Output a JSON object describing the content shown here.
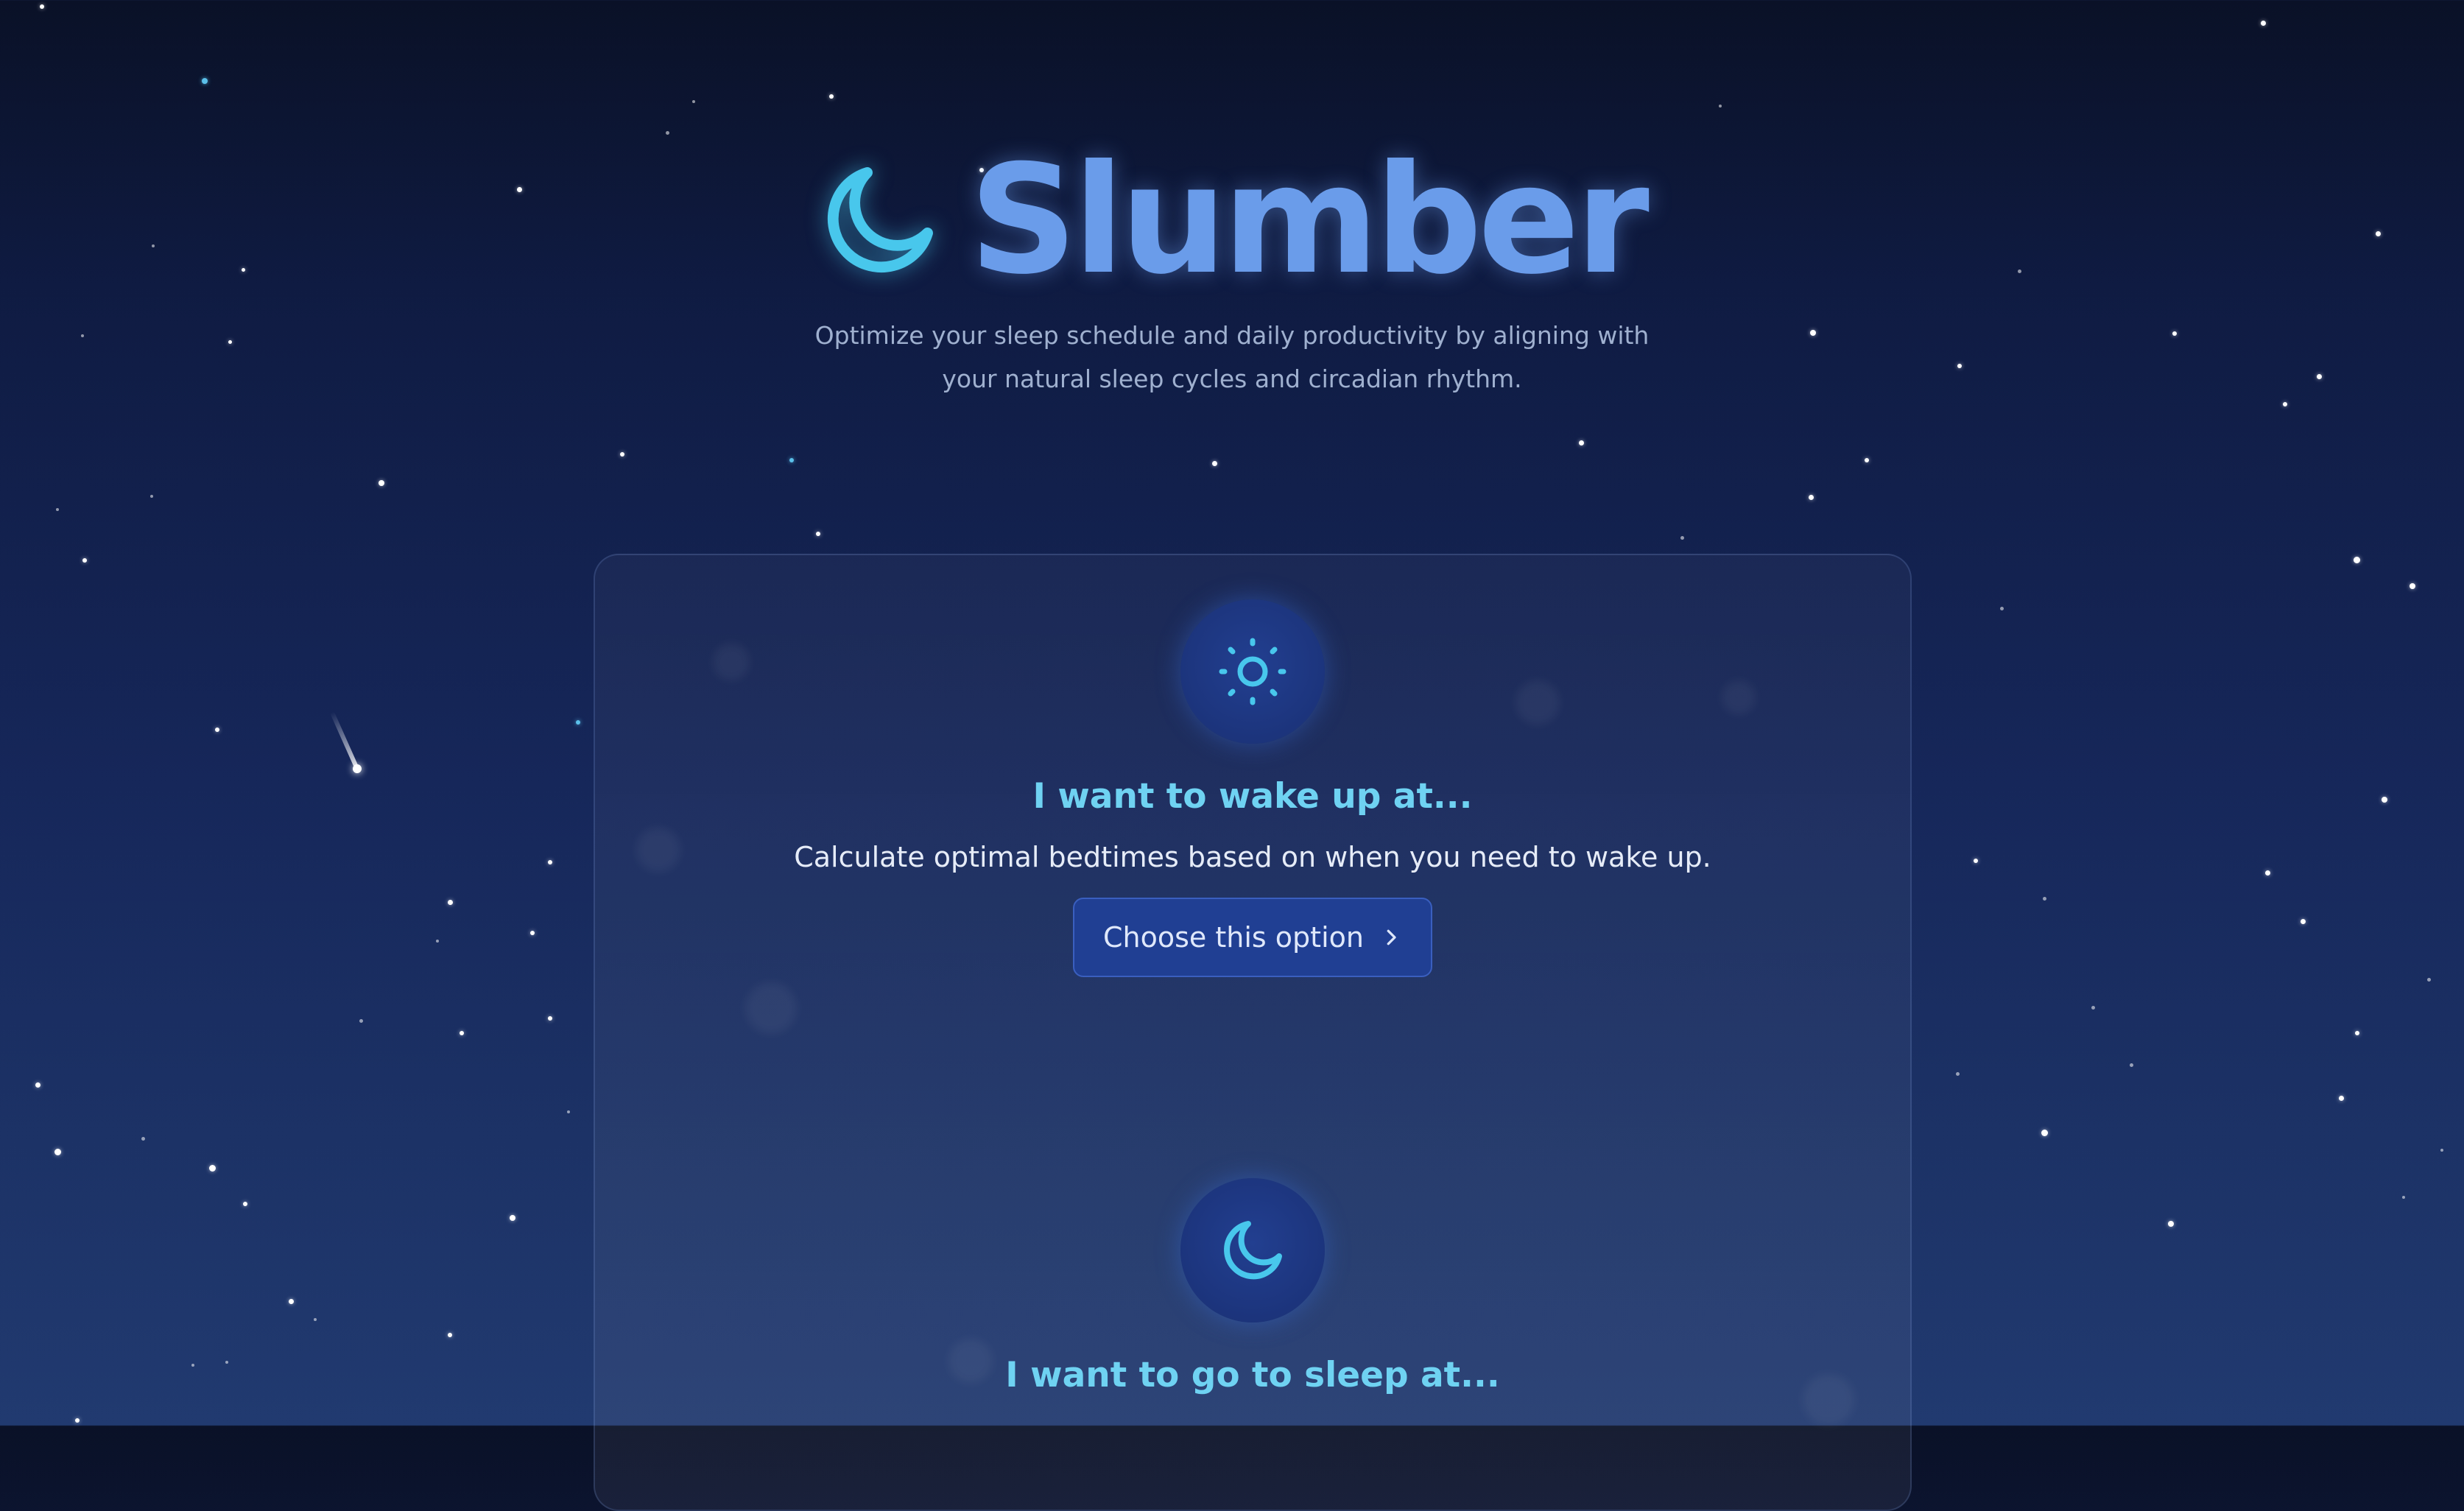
{
  "app": {
    "title": "Slumber",
    "tagline_line1": "Optimize your sleep schedule and daily productivity by aligning with",
    "tagline_line2": "your natural sleep cycles and circadian rhythm."
  },
  "options": [
    {
      "icon": "sun-icon",
      "title": "I want to wake up at...",
      "description": "Calculate optimal bedtimes based on when you need to wake up.",
      "button_label": "Choose this option"
    },
    {
      "icon": "moon-icon",
      "title": "I want to go to sleep at..."
    }
  ],
  "colors": {
    "accent": "#6fd2f2",
    "brand": "#6a9cea",
    "button_bg": "#203f93",
    "background_top": "#0a1127",
    "background_bottom": "#213a70"
  }
}
